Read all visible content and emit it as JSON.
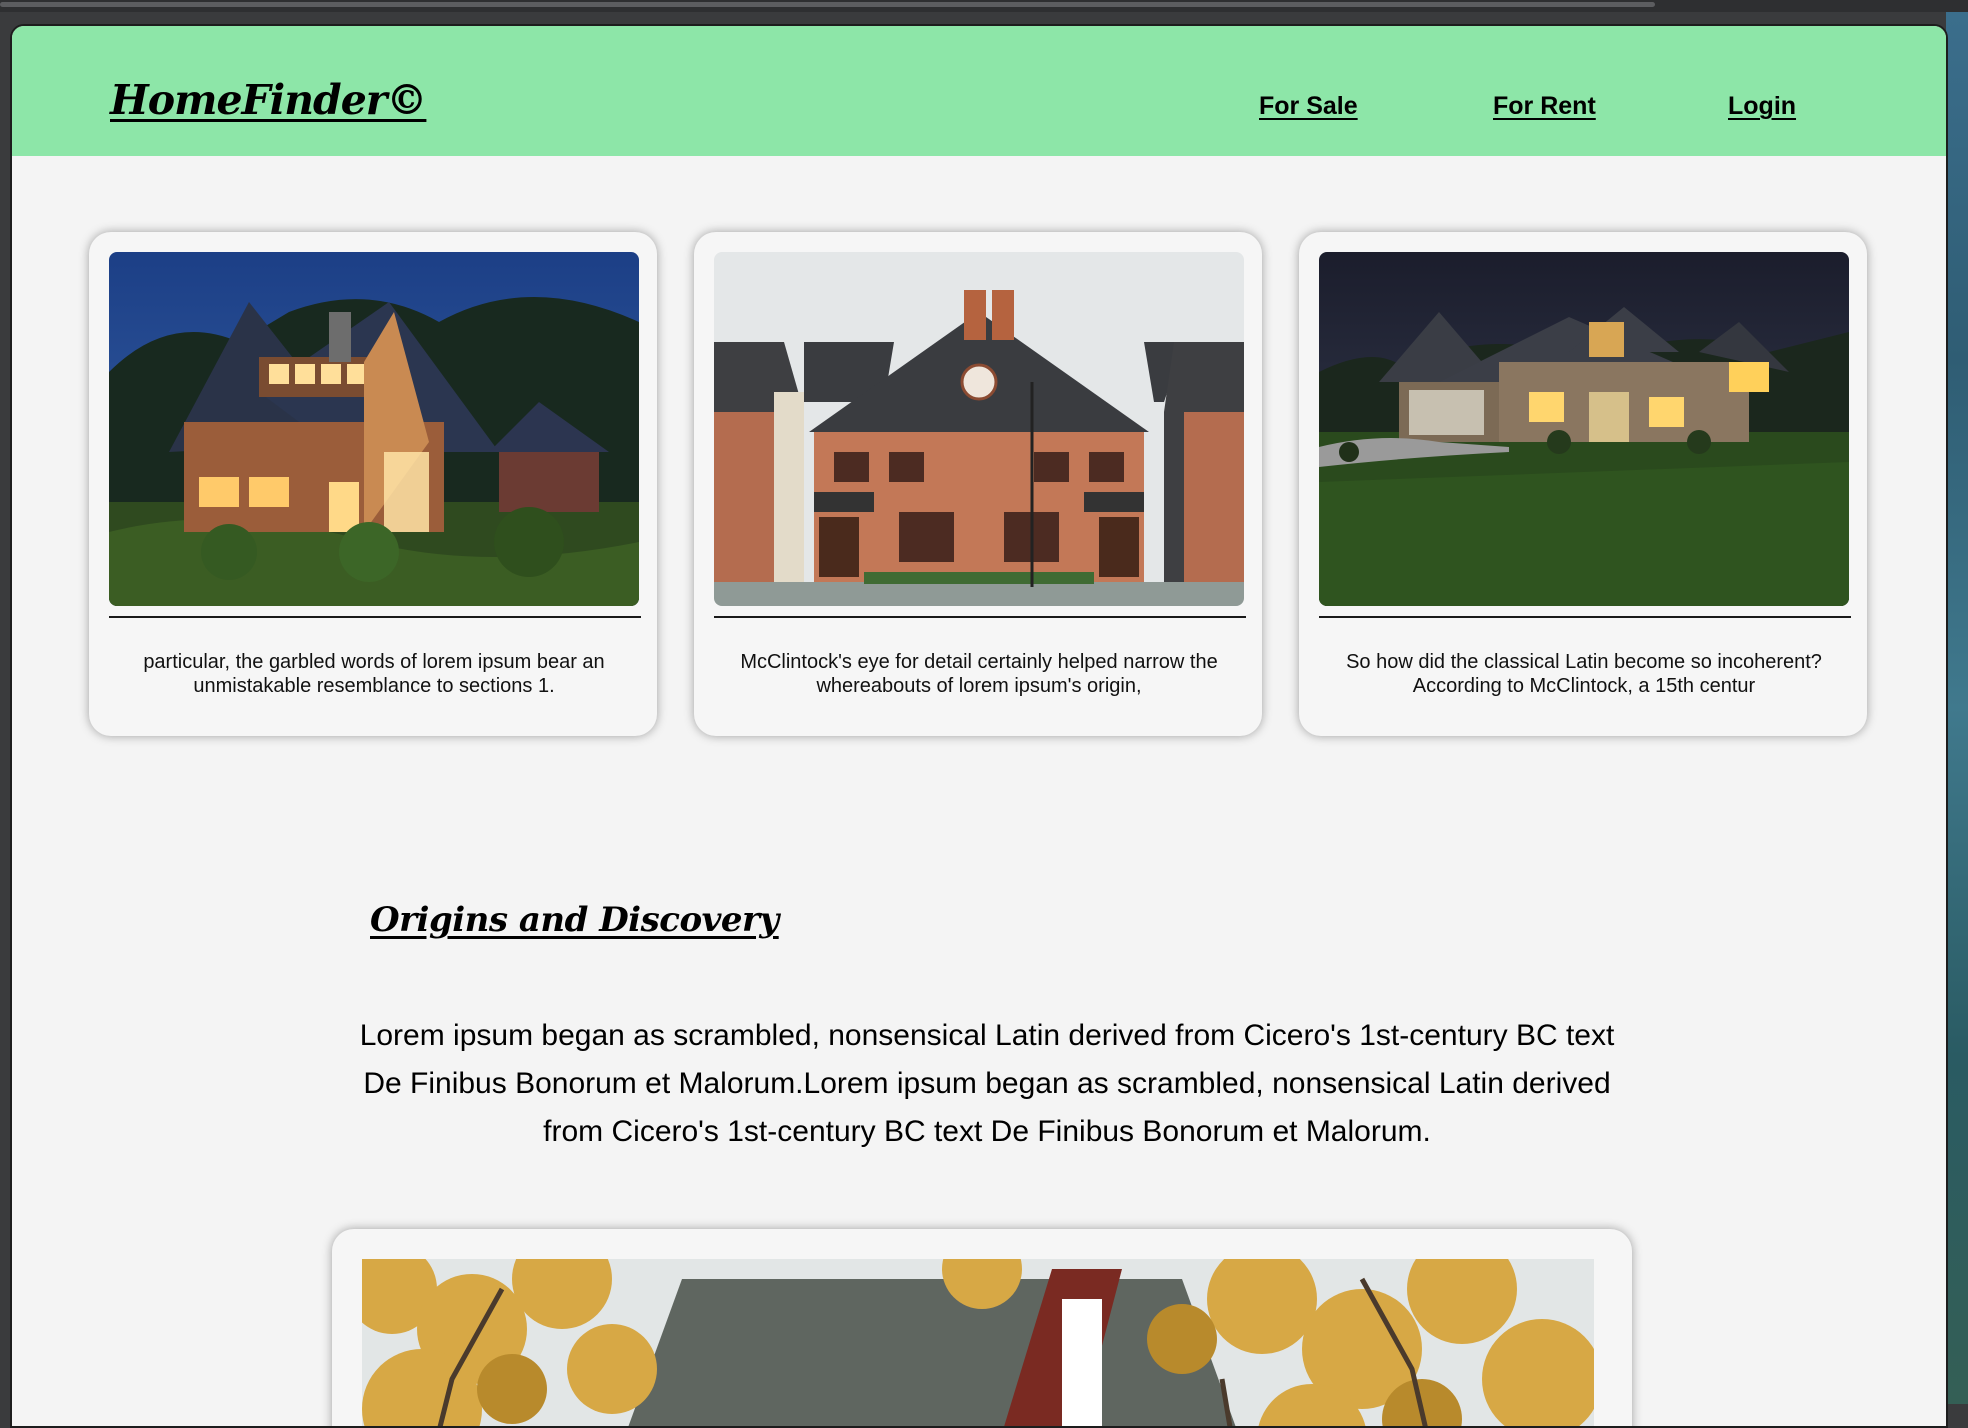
{
  "brand": {
    "logo": "HomeFinder©"
  },
  "nav": {
    "for_sale": "For Sale",
    "for_rent": "For Rent",
    "login": "Login"
  },
  "listings": [
    {
      "caption": "particular, the garbled words of lorem ipsum bear an unmistakable resemblance to sections 1.",
      "image": "modern wooden house at dusk"
    },
    {
      "caption": "McClintock's eye for detail certainly helped narrow the whereabouts of lorem ipsum's origin,",
      "image": "brick townhouse"
    },
    {
      "caption": "So how did the classical Latin become so incoherent? According to McClintock, a 15th centur",
      "image": "suburban house at night with lawn"
    }
  ],
  "section": {
    "heading": "Origins and Discovery",
    "body": "Lorem ipsum began as scrambled, nonsensical Latin derived from Cicero's 1st-century BC text De Finibus Bonorum et Malorum.Lorem ipsum began as scrambled, nonsensical Latin derived from Cicero's 1st-century BC text De Finibus Bonorum et Malorum."
  },
  "feature_image": "house with autumn trees",
  "colors": {
    "navbar": "#8de6a8",
    "page_background": "#f4f4f4"
  }
}
